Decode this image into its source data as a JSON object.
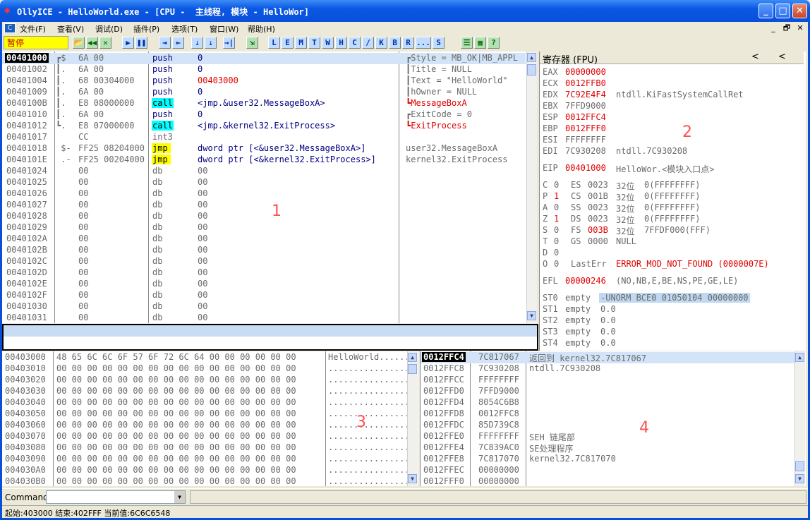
{
  "window": {
    "title": "OllyICE - HelloWorld.exe - [CPU -  主线程, 模块 - HelloWor]",
    "app_icon": "ollyice-bug-icon",
    "buttons": {
      "minimize": "_",
      "maximize": "□",
      "close": "✕"
    }
  },
  "menu": {
    "items": [
      "文件(F)",
      "查看(V)",
      "调试(D)",
      "插件(P)",
      "选项(T)",
      "窗口(W)",
      "帮助(H)"
    ],
    "right_buttons": [
      "_",
      "🗗",
      "✕"
    ]
  },
  "toolbar": {
    "status": "暂停",
    "buttons": [
      "📂",
      "◀◀",
      "✕",
      "▶",
      "❚❚",
      "⇥",
      "⇤",
      "⇣",
      "⇣",
      "→|",
      "⇲",
      "L",
      "E",
      "M",
      "T",
      "W",
      "H",
      "C",
      "/",
      "K",
      "B",
      "R",
      "...",
      "S",
      "☰",
      "▦",
      "?"
    ]
  },
  "disasm": {
    "rows": [
      {
        "addr": "00401000",
        "mark": "┏$",
        "hex": "6A 00",
        "mnem": "push",
        "op": "0",
        "comment": "┏Style = MB_OK|MB_APPL",
        "mnem_style": "",
        "comment_style": "gr",
        "selected": true
      },
      {
        "addr": "00401002",
        "mark": "┃.",
        "hex": "6A 00",
        "mnem": "push",
        "op": "0",
        "comment": "┃Title = NULL",
        "mnem_style": "",
        "comment_style": "gr"
      },
      {
        "addr": "00401004",
        "mark": "┃.",
        "hex": "68 00304000",
        "mnem": "push",
        "op": "00403000",
        "comment": "┃Text = \"HelloWorld\"",
        "mnem_style": "",
        "comment_style": "gr",
        "op_style": "red"
      },
      {
        "addr": "00401009",
        "mark": "┃.",
        "hex": "6A 00",
        "mnem": "push",
        "op": "0",
        "comment": "┃hOwner = NULL",
        "mnem_style": "",
        "comment_style": "gr"
      },
      {
        "addr": "0040100B",
        "mark": "┃.",
        "hex": "E8 08000000",
        "mnem": "call",
        "op": "<jmp.&user32.MessageBoxA>",
        "comment": "┗MessageBoxA",
        "mnem_style": "cyanbg",
        "comment_style": "red"
      },
      {
        "addr": "00401010",
        "mark": "┃.",
        "hex": "6A 00",
        "mnem": "push",
        "op": "0",
        "comment": "┏ExitCode = 0",
        "mnem_style": "",
        "comment_style": "gr"
      },
      {
        "addr": "00401012",
        "mark": "┗.",
        "hex": "E8 07000000",
        "mnem": "call",
        "op": "<jmp.&kernel32.ExitProcess>",
        "comment": "┗ExitProcess",
        "mnem_style": "cyanbg",
        "comment_style": "red"
      },
      {
        "addr": "00401017",
        "mark": "  ",
        "hex": "CC",
        "mnem": "int3",
        "op": "",
        "comment": "",
        "mnem_style": "gr",
        "comment_style": ""
      },
      {
        "addr": "00401018",
        "mark": " $-",
        "hex": "FF25 08204000",
        "mnem": "jmp",
        "op": "dword ptr [<&user32.MessageBoxA>]",
        "comment": "user32.MessageBoxA",
        "mnem_style": "yelbg",
        "comment_style": "gr"
      },
      {
        "addr": "0040101E",
        "mark": " .-",
        "hex": "FF25 00204000",
        "mnem": "jmp",
        "op": "dword ptr [<&kernel32.ExitProcess>]",
        "comment": "kernel32.ExitProcess",
        "mnem_style": "yelbg",
        "comment_style": "gr"
      },
      {
        "addr": "00401024",
        "mark": "  ",
        "hex": "00",
        "mnem": "db",
        "op": "00",
        "comment": "",
        "mnem_style": "gr",
        "comment_style": ""
      },
      {
        "addr": "00401025",
        "mark": "  ",
        "hex": "00",
        "mnem": "db",
        "op": "00",
        "comment": "",
        "mnem_style": "gr",
        "comment_style": ""
      },
      {
        "addr": "00401026",
        "mark": "  ",
        "hex": "00",
        "mnem": "db",
        "op": "00",
        "comment": "",
        "mnem_style": "gr",
        "comment_style": ""
      },
      {
        "addr": "00401027",
        "mark": "  ",
        "hex": "00",
        "mnem": "db",
        "op": "00",
        "comment": "",
        "mnem_style": "gr",
        "comment_style": ""
      },
      {
        "addr": "00401028",
        "mark": "  ",
        "hex": "00",
        "mnem": "db",
        "op": "00",
        "comment": "",
        "mnem_style": "gr",
        "comment_style": ""
      },
      {
        "addr": "00401029",
        "mark": "  ",
        "hex": "00",
        "mnem": "db",
        "op": "00",
        "comment": "",
        "mnem_style": "gr",
        "comment_style": ""
      },
      {
        "addr": "0040102A",
        "mark": "  ",
        "hex": "00",
        "mnem": "db",
        "op": "00",
        "comment": "",
        "mnem_style": "gr",
        "comment_style": ""
      },
      {
        "addr": "0040102B",
        "mark": "  ",
        "hex": "00",
        "mnem": "db",
        "op": "00",
        "comment": "",
        "mnem_style": "gr",
        "comment_style": ""
      },
      {
        "addr": "0040102C",
        "mark": "  ",
        "hex": "00",
        "mnem": "db",
        "op": "00",
        "comment": "",
        "mnem_style": "gr",
        "comment_style": ""
      },
      {
        "addr": "0040102D",
        "mark": "  ",
        "hex": "00",
        "mnem": "db",
        "op": "00",
        "comment": "",
        "mnem_style": "gr",
        "comment_style": ""
      },
      {
        "addr": "0040102E",
        "mark": "  ",
        "hex": "00",
        "mnem": "db",
        "op": "00",
        "comment": "",
        "mnem_style": "gr",
        "comment_style": ""
      },
      {
        "addr": "0040102F",
        "mark": "  ",
        "hex": "00",
        "mnem": "db",
        "op": "00",
        "comment": "",
        "mnem_style": "gr",
        "comment_style": ""
      },
      {
        "addr": "00401030",
        "mark": "  ",
        "hex": "00",
        "mnem": "db",
        "op": "00",
        "comment": "",
        "mnem_style": "gr",
        "comment_style": ""
      },
      {
        "addr": "00401031",
        "mark": "  ",
        "hex": "00",
        "mnem": "db",
        "op": "00",
        "comment": "",
        "mnem_style": "gr",
        "comment_style": ""
      }
    ],
    "overlay_label": "1"
  },
  "registers": {
    "header": "寄存器 (FPU)",
    "nav": [
      "<",
      "<"
    ],
    "gprs": [
      {
        "name": "EAX",
        "val": "00000000",
        "note": "",
        "red": true
      },
      {
        "name": "ECX",
        "val": "0012FFB0",
        "note": "",
        "red": true
      },
      {
        "name": "EDX",
        "val": "7C92E4F4",
        "note": "ntdll.KiFastSystemCallRet",
        "red": true
      },
      {
        "name": "EBX",
        "val": "7FFD9000",
        "note": "",
        "red": false
      },
      {
        "name": "ESP",
        "val": "0012FFC4",
        "note": "",
        "red": true
      },
      {
        "name": "EBP",
        "val": "0012FFF0",
        "note": "",
        "red": true
      },
      {
        "name": "ESI",
        "val": "FFFFFFFF",
        "note": "",
        "red": false
      },
      {
        "name": "EDI",
        "val": "7C930208",
        "note": "ntdll.7C930208",
        "red": false
      }
    ],
    "eip": {
      "name": "EIP",
      "val": "00401000",
      "note": "HelloWor.<模块入口点>"
    },
    "flags": [
      {
        "f": "C",
        "v": "0",
        "seg": "ES",
        "sv": "0023",
        "bits": "32位",
        "rng": "0(FFFFFFFF)",
        "vred": false,
        "svred": false
      },
      {
        "f": "P",
        "v": "1",
        "seg": "CS",
        "sv": "001B",
        "bits": "32位",
        "rng": "0(FFFFFFFF)",
        "vred": true,
        "svred": false
      },
      {
        "f": "A",
        "v": "0",
        "seg": "SS",
        "sv": "0023",
        "bits": "32位",
        "rng": "0(FFFFFFFF)",
        "vred": false,
        "svred": false
      },
      {
        "f": "Z",
        "v": "1",
        "seg": "DS",
        "sv": "0023",
        "bits": "32位",
        "rng": "0(FFFFFFFF)",
        "vred": true,
        "svred": false
      },
      {
        "f": "S",
        "v": "0",
        "seg": "FS",
        "sv": "003B",
        "bits": "32位",
        "rng": "7FFDF000(FFF)",
        "vred": false,
        "svred": true
      },
      {
        "f": "T",
        "v": "0",
        "seg": "GS",
        "sv": "0000",
        "bits": "NULL",
        "rng": "",
        "vred": false,
        "svred": false
      },
      {
        "f": "D",
        "v": "0",
        "seg": "",
        "sv": "",
        "bits": "",
        "rng": "",
        "vred": false,
        "svred": false
      },
      {
        "f": "O",
        "v": "0",
        "seg": "LastErr",
        "sv": "",
        "bits": "ERROR_MOD_NOT_FOUND (0000007E)",
        "rng": "",
        "vred": false,
        "svred": false
      }
    ],
    "efl": {
      "name": "EFL",
      "val": "00000246",
      "note": "(NO,NB,E,BE,NS,PE,GE,LE)"
    },
    "fpu": [
      {
        "name": "ST0",
        "state": "empty",
        "val": "-UNORM BCE0 01050104 00000000",
        "hl": true
      },
      {
        "name": "ST1",
        "state": "empty",
        "val": "0.0",
        "hl": false
      },
      {
        "name": "ST2",
        "state": "empty",
        "val": "0.0",
        "hl": false
      },
      {
        "name": "ST3",
        "state": "empty",
        "val": "0.0",
        "hl": false
      },
      {
        "name": "ST4",
        "state": "empty",
        "val": "0.0",
        "hl": false
      }
    ],
    "overlay_label": "2"
  },
  "dump": {
    "rows": [
      {
        "addr": "00403000",
        "hex": "48 65 6C 6C 6F 57 6F 72 6C 64 00 00 00 00 00 00",
        "ascii": "HelloWorld......"
      },
      {
        "addr": "00403010",
        "hex": "00 00 00 00 00 00 00 00 00 00 00 00 00 00 00 00",
        "ascii": "................"
      },
      {
        "addr": "00403020",
        "hex": "00 00 00 00 00 00 00 00 00 00 00 00 00 00 00 00",
        "ascii": "................"
      },
      {
        "addr": "00403030",
        "hex": "00 00 00 00 00 00 00 00 00 00 00 00 00 00 00 00",
        "ascii": "................"
      },
      {
        "addr": "00403040",
        "hex": "00 00 00 00 00 00 00 00 00 00 00 00 00 00 00 00",
        "ascii": "................"
      },
      {
        "addr": "00403050",
        "hex": "00 00 00 00 00 00 00 00 00 00 00 00 00 00 00 00",
        "ascii": "................"
      },
      {
        "addr": "00403060",
        "hex": "00 00 00 00 00 00 00 00 00 00 00 00 00 00 00 00",
        "ascii": "................"
      },
      {
        "addr": "00403070",
        "hex": "00 00 00 00 00 00 00 00 00 00 00 00 00 00 00 00",
        "ascii": "................"
      },
      {
        "addr": "00403080",
        "hex": "00 00 00 00 00 00 00 00 00 00 00 00 00 00 00 00",
        "ascii": "................"
      },
      {
        "addr": "00403090",
        "hex": "00 00 00 00 00 00 00 00 00 00 00 00 00 00 00 00",
        "ascii": "................"
      },
      {
        "addr": "004030A0",
        "hex": "00 00 00 00 00 00 00 00 00 00 00 00 00 00 00 00",
        "ascii": "................"
      },
      {
        "addr": "004030B0",
        "hex": "00 00 00 00 00 00 00 00 00 00 00 00 00 00 00 00",
        "ascii": "................"
      }
    ],
    "overlay_label": "3"
  },
  "stack": {
    "rows": [
      {
        "addr": "0012FFC4",
        "val": "7C817067",
        "note": "返回到 kernel32.7C817067",
        "sel": true
      },
      {
        "addr": "0012FFC8",
        "val": "7C930208",
        "note": "ntdll.7C930208",
        "sel": false
      },
      {
        "addr": "0012FFCC",
        "val": "FFFFFFFF",
        "note": "",
        "sel": false
      },
      {
        "addr": "0012FFD0",
        "val": "7FFD9000",
        "note": "",
        "sel": false
      },
      {
        "addr": "0012FFD4",
        "val": "8054C6B8",
        "note": "",
        "sel": false
      },
      {
        "addr": "0012FFD8",
        "val": "0012FFC8",
        "note": "",
        "sel": false
      },
      {
        "addr": "0012FFDC",
        "val": "85D739C8",
        "note": "",
        "sel": false
      },
      {
        "addr": "0012FFE0",
        "val": "FFFFFFFF",
        "note": "SEH 链尾部",
        "sel": false
      },
      {
        "addr": "0012FFE4",
        "val": "7C839AC0",
        "note": "SE处理程序",
        "sel": false
      },
      {
        "addr": "0012FFE8",
        "val": "7C817070",
        "note": "kernel32.7C817070",
        "sel": false
      },
      {
        "addr": "0012FFEC",
        "val": "00000000",
        "note": "",
        "sel": false
      },
      {
        "addr": "0012FFF0",
        "val": "00000000",
        "note": "",
        "sel": false
      }
    ],
    "overlay_label": "4"
  },
  "command": {
    "label": "Command",
    "value": ""
  },
  "statusbar": {
    "text": "起始:403000 结束:402FFF 当前值:6C6C6548"
  }
}
